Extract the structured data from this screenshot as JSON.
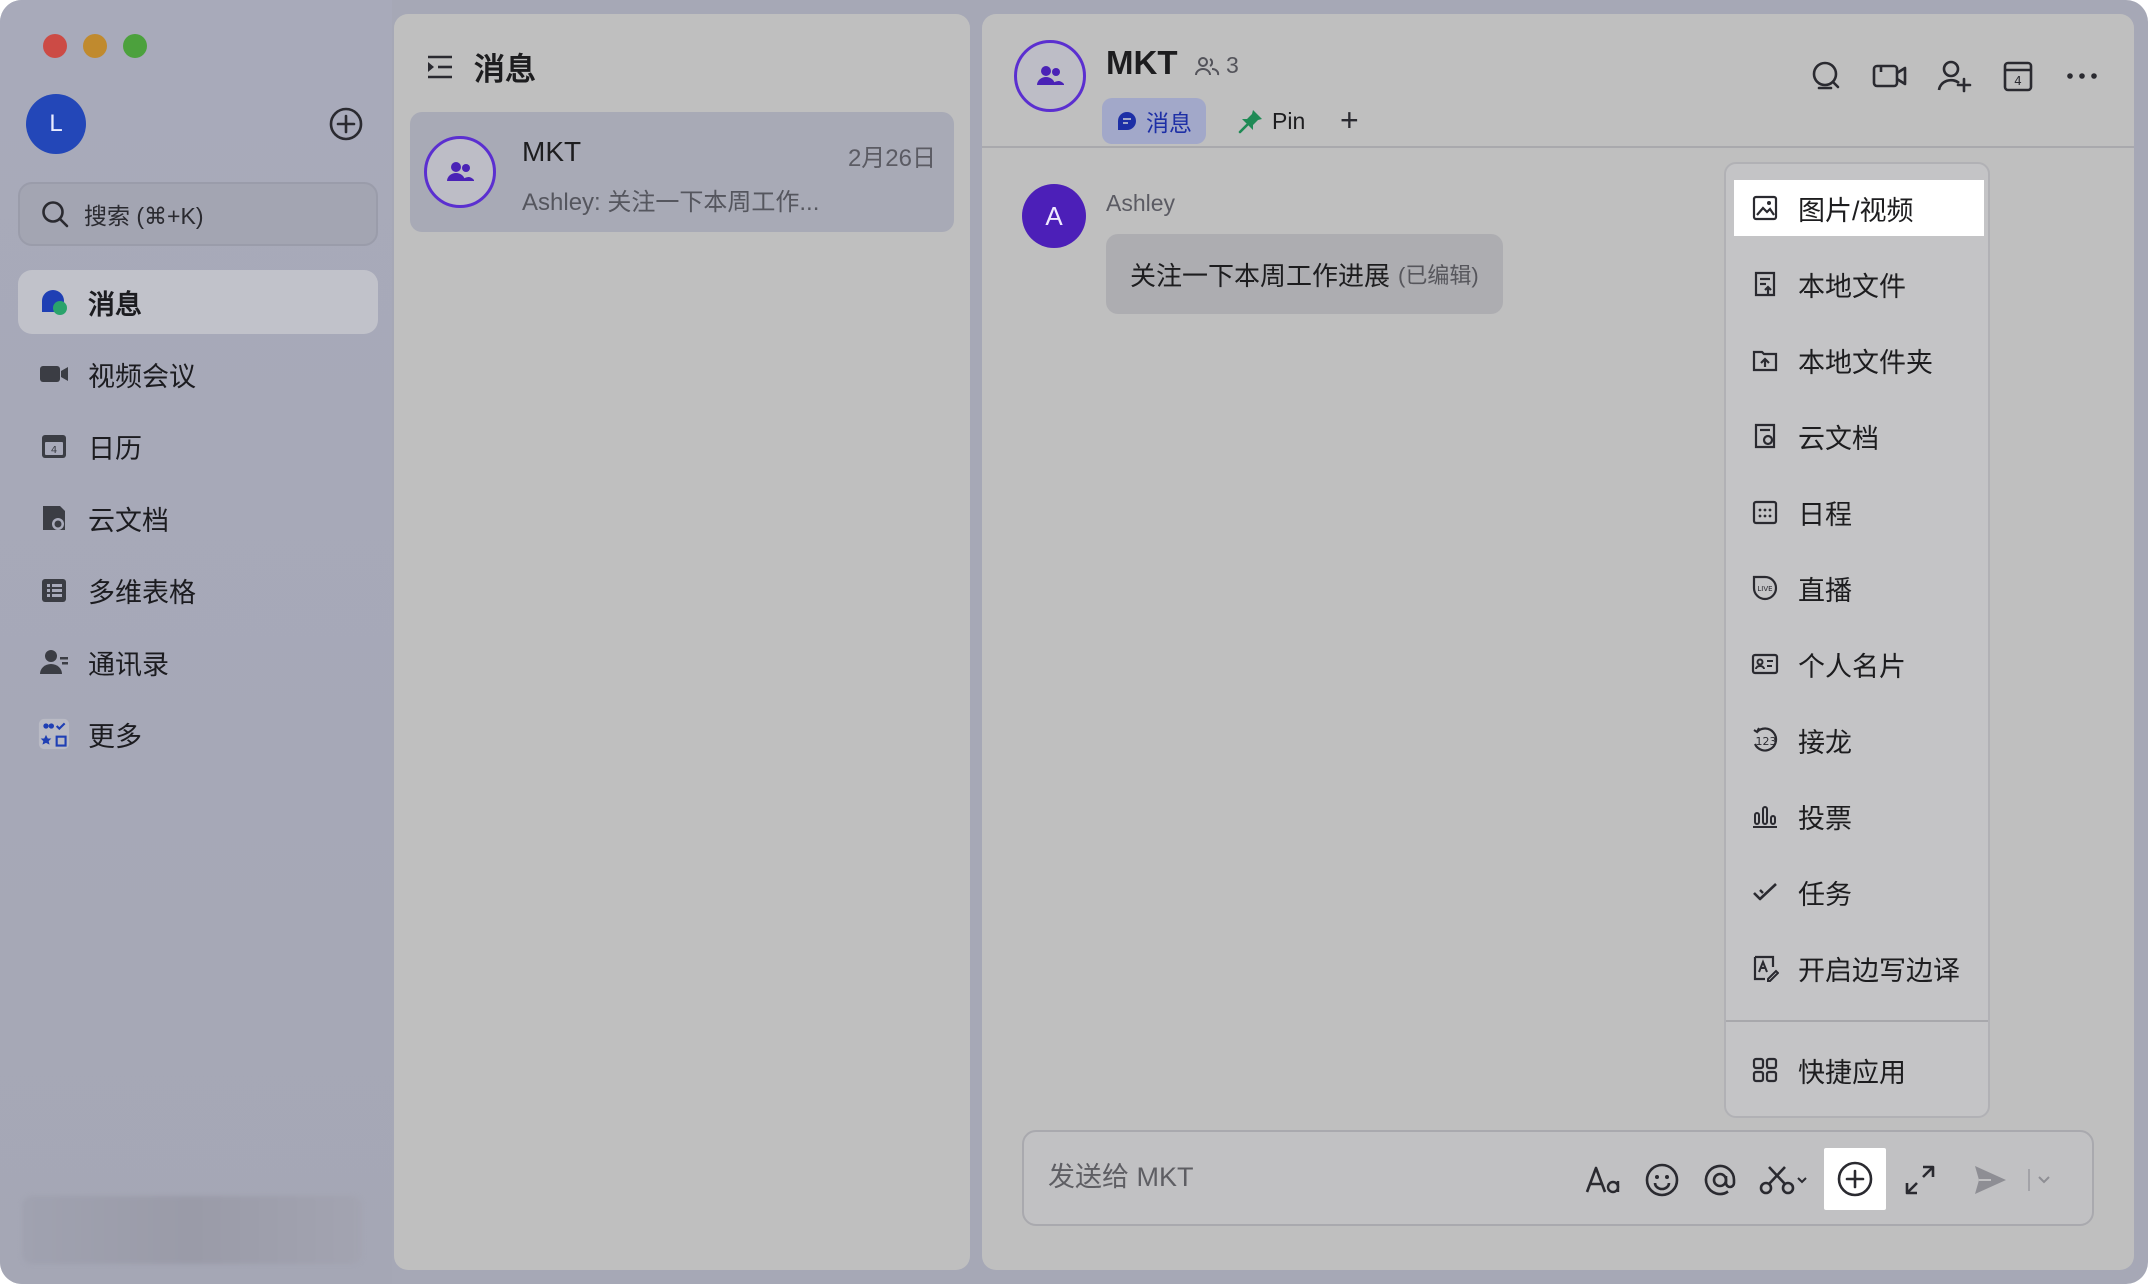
{
  "sidebar": {
    "avatar_letter": "L",
    "search_placeholder": "搜索 (⌘+K)",
    "nav": [
      {
        "label": "消息",
        "icon": "chat-bubble-icon"
      },
      {
        "label": "视频会议",
        "icon": "video-camera-icon"
      },
      {
        "label": "日历",
        "icon": "calendar-icon"
      },
      {
        "label": "云文档",
        "icon": "cloud-doc-icon"
      },
      {
        "label": "多维表格",
        "icon": "table-icon"
      },
      {
        "label": "通讯录",
        "icon": "contacts-icon"
      },
      {
        "label": "更多",
        "icon": "apps-grid-icon"
      }
    ]
  },
  "list": {
    "title": "消息",
    "chats": [
      {
        "name": "MKT",
        "date": "2月26日",
        "preview": "Ashley: 关注一下本周工作..."
      }
    ]
  },
  "chat": {
    "title": "MKT",
    "member_count": "3",
    "tabs": [
      {
        "label": "消息"
      },
      {
        "label": "Pin"
      }
    ],
    "messages": [
      {
        "avatar_letter": "A",
        "sender": "Ashley",
        "text": "关注一下本周工作进展",
        "edited": "(已编辑)"
      }
    ],
    "composer_placeholder": "发送给 MKT"
  },
  "popup_menu": {
    "items": [
      {
        "label": "图片/视频",
        "icon": "image-icon"
      },
      {
        "label": "本地文件",
        "icon": "local-file-icon"
      },
      {
        "label": "本地文件夹",
        "icon": "folder-upload-icon"
      },
      {
        "label": "云文档",
        "icon": "cloud-doc-icon"
      },
      {
        "label": "日程",
        "icon": "schedule-icon"
      },
      {
        "label": "直播",
        "icon": "live-icon"
      },
      {
        "label": "个人名片",
        "icon": "business-card-icon"
      },
      {
        "label": "接龙",
        "icon": "relay-icon"
      },
      {
        "label": "投票",
        "icon": "vote-icon"
      },
      {
        "label": "任务",
        "icon": "task-icon"
      },
      {
        "label": "开启边写边译",
        "icon": "translate-icon"
      }
    ],
    "footer_item": {
      "label": "快捷应用",
      "icon": "quick-apps-icon"
    }
  },
  "colors": {
    "accent_blue": "#2347b8",
    "group_purple": "#5b2fd0",
    "pin_green": "#1f8a55"
  }
}
